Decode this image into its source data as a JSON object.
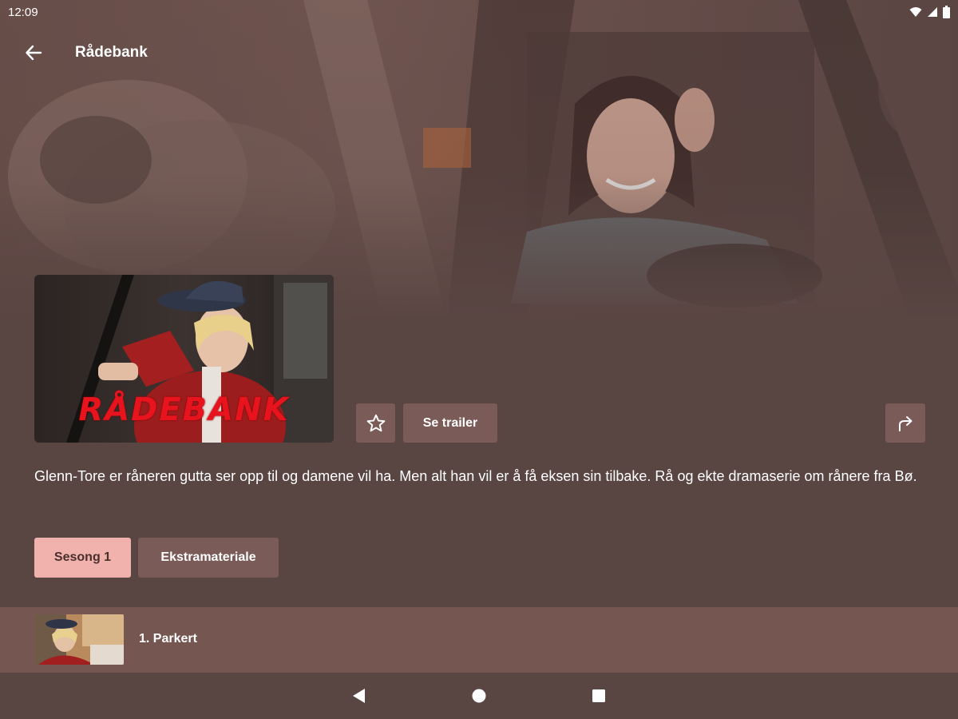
{
  "status_bar": {
    "time": "12:09",
    "icons": [
      "wifi-icon",
      "cell-signal-icon",
      "battery-icon"
    ]
  },
  "app_bar": {
    "back_icon": "arrow-left-icon",
    "title": "Rådebank"
  },
  "poster": {
    "logo_text": "RÅDEBANK"
  },
  "actions": {
    "favorite_icon": "star-outline-icon",
    "trailer_label": "Se trailer",
    "share_icon": "share-arrow-icon"
  },
  "description": "Glenn-Tore er råneren gutta ser opp til og damene vil ha. Men alt han vil er å få eksen sin tilbake. Rå og ekte dramaserie om rånere fra Bø.",
  "tabs": [
    {
      "label": "Sesong 1",
      "selected": true
    },
    {
      "label": "Ekstramateriale",
      "selected": false
    }
  ],
  "episodes": [
    {
      "title": "1. Parkert"
    }
  ],
  "nav_bar": {
    "icons": [
      "triangle-back-icon",
      "circle-home-icon",
      "square-recents-icon"
    ]
  },
  "colors": {
    "background": "#594542",
    "button": "#7a5b57",
    "selected_tab": "#f1b2ad",
    "episode_row": "#755651",
    "logo_red": "#e8141d"
  }
}
